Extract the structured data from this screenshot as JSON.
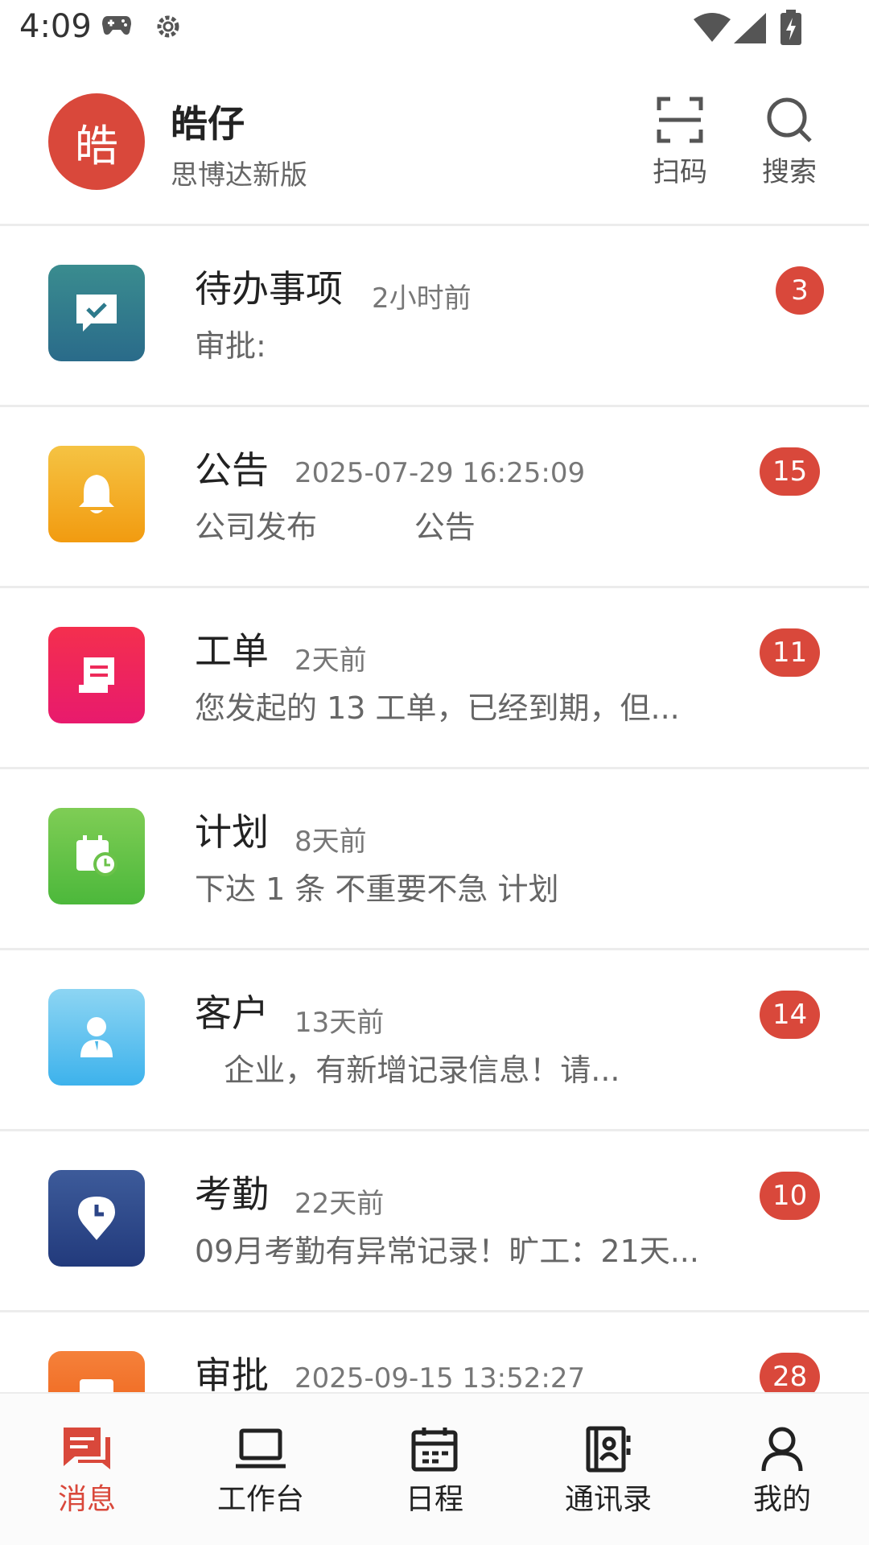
{
  "status_bar": {
    "time": "4:09",
    "icons": [
      "gamepad-icon",
      "gear-icon",
      "wifi-icon",
      "signal-icon",
      "battery-charging-icon"
    ]
  },
  "header": {
    "avatar_text": "皓",
    "user_name": "皓仔",
    "company": "思博达新版",
    "actions": [
      {
        "label": "扫码",
        "icon": "scan-icon"
      },
      {
        "label": "搜索",
        "icon": "search-icon"
      }
    ]
  },
  "messages": [
    {
      "title": "待办事项",
      "time": "2小时前",
      "preview": "审批:",
      "badge": "3",
      "icon": "todo-chat-icon",
      "color": "#2f7a8c"
    },
    {
      "title": "公告",
      "time": "2025-07-29 16:25:09",
      "preview": "公司发布          公告",
      "badge": "15",
      "icon": "bell-icon",
      "color": "#f3a51f"
    },
    {
      "title": "工单",
      "time": "2天前",
      "preview": "您发起的 13 工单，已经到期，但...",
      "badge": "11",
      "icon": "scroll-icon",
      "color": "#ee2a5a"
    },
    {
      "title": "计划",
      "time": "8天前",
      "preview": "下达 1 条 不重要不急 计划",
      "badge": "",
      "icon": "calendar-clock-icon",
      "color": "#6bc24a"
    },
    {
      "title": "客户",
      "time": "13天前",
      "preview": "   企业，有新增记录信息！请...",
      "badge": "14",
      "icon": "person-icon",
      "color": "#4bb8e8"
    },
    {
      "title": "考勤",
      "time": "22天前",
      "preview": "09月考勤有异常记录！旷工：21天...",
      "badge": "10",
      "icon": "clock-pin-icon",
      "color": "#2c4587"
    },
    {
      "title": "审批",
      "time": "2025-09-15 13:52:27",
      "preview": "",
      "badge": "28",
      "icon": "document-icon",
      "color": "#f06d1f"
    }
  ],
  "bottom_nav": [
    {
      "label": "消息",
      "icon": "message-icon",
      "active": true
    },
    {
      "label": "工作台",
      "icon": "laptop-icon",
      "active": false
    },
    {
      "label": "日程",
      "icon": "calendar-icon",
      "active": false
    },
    {
      "label": "通讯录",
      "icon": "contacts-icon",
      "active": false
    },
    {
      "label": "我的",
      "icon": "user-icon",
      "active": false
    }
  ],
  "colors": {
    "accent": "#d9483b",
    "badge": "#d9483b",
    "divider": "#ececec"
  }
}
